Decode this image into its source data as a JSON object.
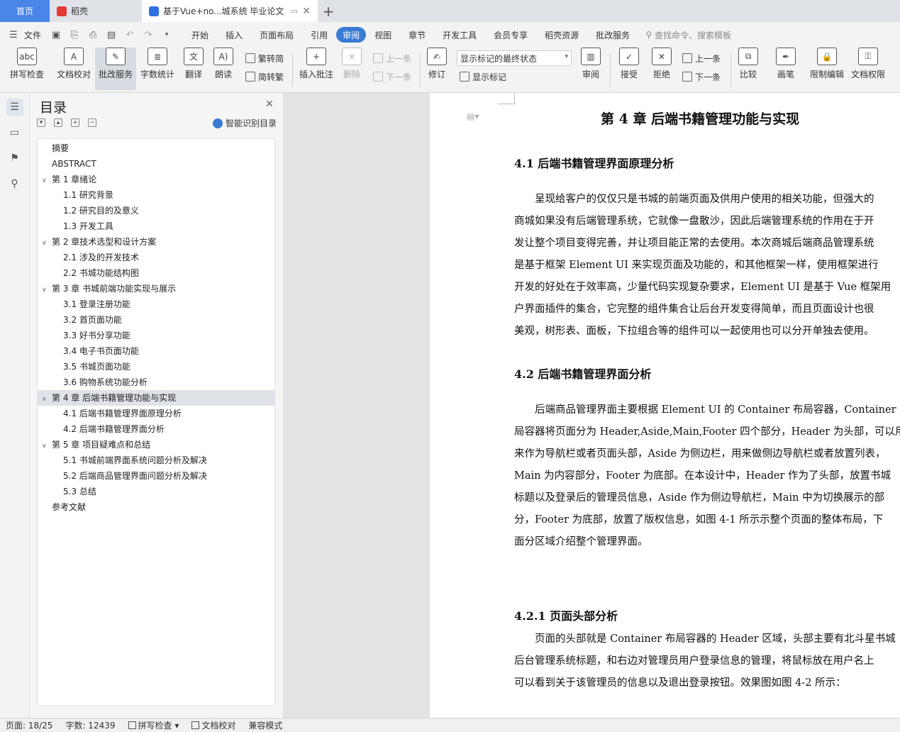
{
  "tabs": {
    "home": "首页",
    "daoke": "稻壳",
    "doc": "基于Vue+no...城系统 毕业论文"
  },
  "menu": {
    "file": "文件",
    "tabs": [
      "开始",
      "插入",
      "页面布局",
      "引用",
      "审阅",
      "视图",
      "章节",
      "开发工具",
      "会员专享",
      "稻壳资源",
      "批改服务"
    ],
    "active_tab": "审阅",
    "search_placeholder": "查找命令、搜索模板"
  },
  "ribbon": {
    "spellcheck": "拼写检查",
    "doc_proof": "文档校对",
    "review_service": "批改服务",
    "word_count": "字数统计",
    "translate": "翻译",
    "read_aloud": "朗读",
    "trad_simplified": "繁转简",
    "simplified_trad": "简转繁",
    "insert_comment": "插入批注",
    "delete": "删除",
    "prev": "上一条",
    "next": "下一条",
    "track_changes": "修订",
    "display_mode": "显示标记的最终状态",
    "show_markup": "显示标记",
    "review": "审阅",
    "accept": "接受",
    "reject": "拒绝",
    "prev2": "上一条",
    "next2": "下一条",
    "compare": "比较",
    "ink": "画笔",
    "restrict_edit": "限制编辑",
    "doc_permission": "文档权限"
  },
  "toc": {
    "title": "目录",
    "smart_toc": "智能识别目录",
    "items": [
      {
        "label": "摘要",
        "level": 1
      },
      {
        "label": "ABSTRACT",
        "level": 1
      },
      {
        "label": "第 1 章绪论",
        "level": 1,
        "caret": true
      },
      {
        "label": "1.1  研究背景",
        "level": 2
      },
      {
        "label": "1.2  研究目的及意义",
        "level": 2
      },
      {
        "label": "1.3  开发工具",
        "level": 2
      },
      {
        "label": "第 2 章技术选型和设计方案",
        "level": 1,
        "caret": true
      },
      {
        "label": "2.1  涉及的开发技术",
        "level": 2
      },
      {
        "label": "2.2  书城功能结构图",
        "level": 2
      },
      {
        "label": "第 3 章  书城前端功能实现与展示",
        "level": 1,
        "caret": true
      },
      {
        "label": "3.1  登录注册功能",
        "level": 2
      },
      {
        "label": "3.2  首页面功能",
        "level": 2
      },
      {
        "label": "3.3  好书分享功能",
        "level": 2
      },
      {
        "label": "3.4  电子书页面功能",
        "level": 2
      },
      {
        "label": "3.5  书城页面功能",
        "level": 2
      },
      {
        "label": "3.6  购物系统功能分析",
        "level": 2
      },
      {
        "label": "第 4 章  后端书籍管理功能与实现",
        "level": 1,
        "caret": true,
        "selected": true
      },
      {
        "label": "4.1  后端书籍管理界面原理分析",
        "level": 2
      },
      {
        "label": "4.2  后端书籍管理界面分析",
        "level": 2
      },
      {
        "label": "第 5 章  项目疑难点和总结",
        "level": 1,
        "caret": true
      },
      {
        "label": "5.1  书城前端界面系统问题分析及解决",
        "level": 2
      },
      {
        "label": "5.2  后端商品管理界面问题分析及解决",
        "level": 2
      },
      {
        "label": "5.3  总结",
        "level": 2
      },
      {
        "label": "参考文献",
        "level": 1
      }
    ]
  },
  "document": {
    "chapter_title": "第 4 章  后端书籍管理功能与实现",
    "s41_title": "4.1  后端书籍管理界面原理分析",
    "s41_lines": [
      "　　呈现给客户的仅仅只是书城的前端页面及供用户使用的相关功能，但强大的",
      "商城如果没有后端管理系统，它就像一盘散沙，因此后端管理系统的作用在于开",
      "发让整个项目变得完善，并让项目能正常的去使用。本次商城后端商品管理系统",
      "是基于框架 Element UI 来实现页面及功能的，和其他框架一样，使用框架进行",
      "开发的好处在于效率高，少量代码实现复杂要求，Element UI 是基于 Vue 框架用",
      "户界面插件的集合，它完整的组件集合让后台开发变得简单，而且页面设计也很",
      "美观，树形表、面板，下拉组合等的组件可以一起使用也可以分开单独去使用。"
    ],
    "s42_title": "4.2  后端书籍管理界面分析",
    "s42_lines": [
      "　　后端商品管理界面主要根据 Element UI 的 Container 布局容器，Container 布",
      "局容器将页面分为 Header,Aside,Main,Footer 四个部分，Header 为头部，可以用",
      "来作为导航栏或者页面头部，Aside 为侧边栏，用来做侧边导航栏或者放置列表，",
      "Main 为内容部分，Footer 为底部。在本设计中，Header 作为了头部，放置书城",
      "标题以及登录后的管理员信息，Aside 作为侧边导航栏，Main 中为切换展示的部",
      "分，Footer 为底部，放置了版权信息，如图 4-1 所示示整个页面的整体布局，下",
      "面分区域介绍整个管理界面。"
    ],
    "s421_title": "4.2.1  页面头部分析",
    "s421_lines": [
      "　　页面的头部就是 Container 布局容器的 Header 区域，头部主要有北斗星书城",
      "后台管理系统标题，和右边对管理员用户登录信息的管理，将鼠标放在用户名上",
      "可以看到关于该管理员的信息以及退出登录按钮。效果图如图 4-2 所示："
    ]
  },
  "status": {
    "page": "页面: 18/25",
    "words": "字数: 12439",
    "spellcheck": "拼写检查",
    "proof": "文档校对",
    "compat": "兼容模式"
  }
}
